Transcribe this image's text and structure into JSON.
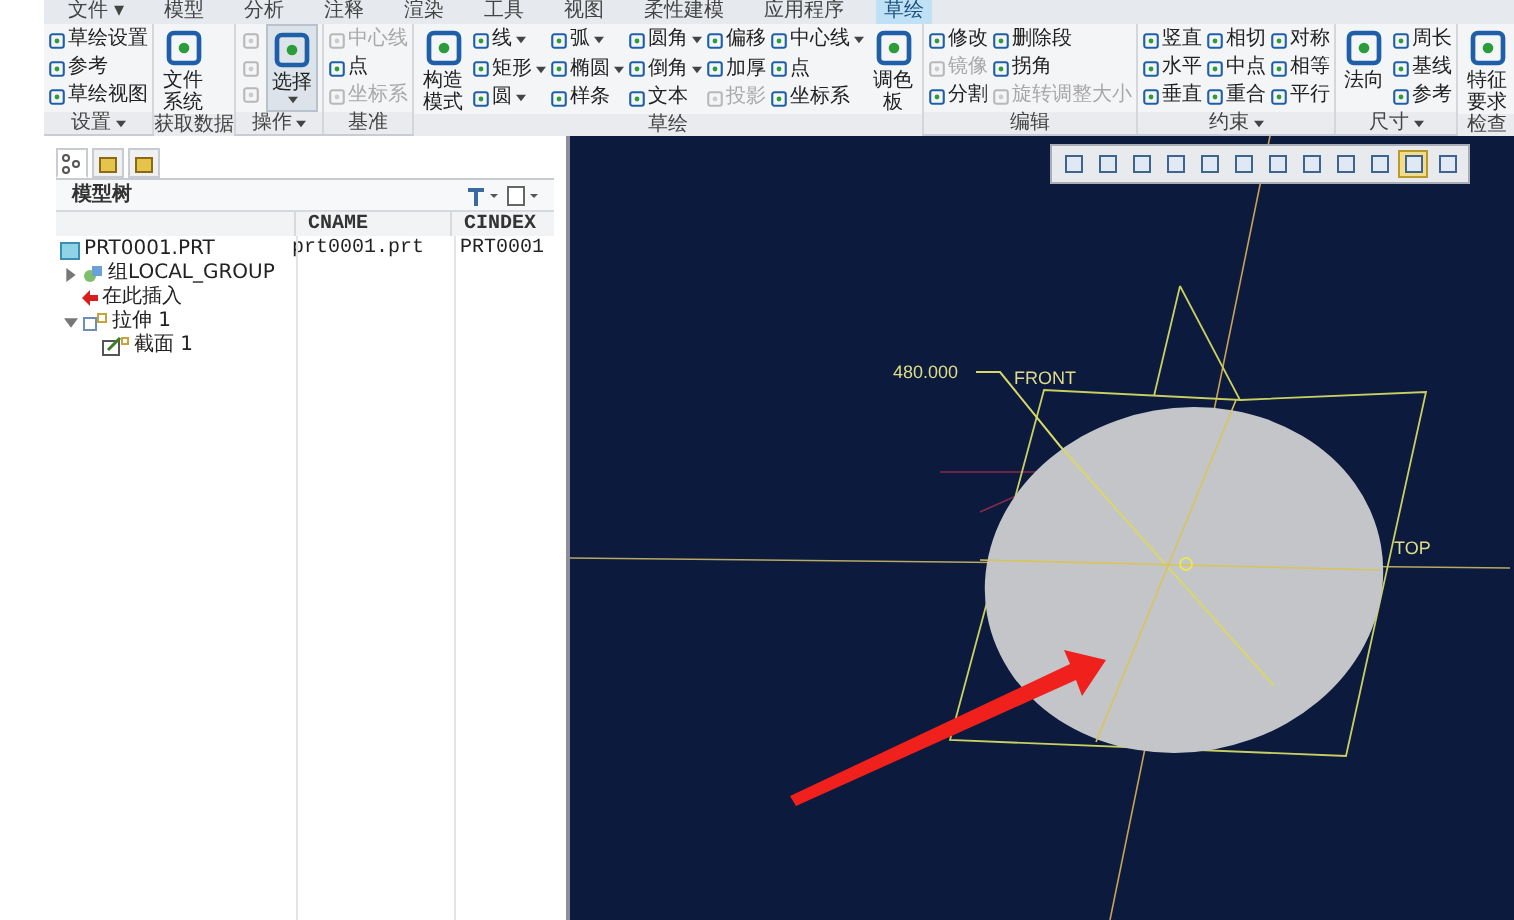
{
  "menu_tabs": [
    {
      "label": "文件 ▾",
      "selected": false
    },
    {
      "label": "模型",
      "selected": false
    },
    {
      "label": "分析",
      "selected": false
    },
    {
      "label": "注释",
      "selected": false
    },
    {
      "label": "渲染",
      "selected": false
    },
    {
      "label": "工具",
      "selected": false
    },
    {
      "label": "视图",
      "selected": false
    },
    {
      "label": "柔性建模",
      "selected": false
    },
    {
      "label": "应用程序",
      "selected": false
    },
    {
      "label": "草绘",
      "selected": true
    }
  ],
  "ribbon": [
    {
      "label": "设置",
      "menu": true,
      "columns": [
        {
          "kind": "stack",
          "items": [
            {
              "label": "草绘设置",
              "disabled": false,
              "menu": false
            },
            {
              "label": "参考",
              "disabled": false,
              "menu": false
            },
            {
              "label": "草绘视图",
              "disabled": false,
              "menu": false
            }
          ]
        }
      ]
    },
    {
      "label": "获取数据",
      "menu": false,
      "columns": [
        {
          "kind": "large",
          "label": "文件系统",
          "menu": false,
          "selected": false
        }
      ]
    },
    {
      "label": "操作",
      "menu": true,
      "columns": [
        {
          "kind": "icons",
          "items": [
            {
              "disabled": true
            },
            {
              "disabled": true
            },
            {
              "disabled": true
            }
          ]
        },
        {
          "kind": "large",
          "label": "选择",
          "menu": true,
          "selected": true
        }
      ]
    },
    {
      "label": "基准",
      "menu": false,
      "columns": [
        {
          "kind": "stack",
          "items": [
            {
              "label": "中心线",
              "disabled": true,
              "menu": false
            },
            {
              "label": "点",
              "disabled": false,
              "menu": false
            },
            {
              "label": "坐标系",
              "disabled": true,
              "menu": false
            }
          ]
        }
      ]
    },
    {
      "label": "草绘",
      "menu": false,
      "columns": [
        {
          "kind": "large",
          "label": "构造模式",
          "menu": false,
          "selected": false
        },
        {
          "kind": "stack",
          "items": [
            {
              "label": "线",
              "disabled": false,
              "menu": true
            },
            {
              "label": "矩形",
              "disabled": false,
              "menu": true
            },
            {
              "label": "圆",
              "disabled": false,
              "menu": true
            }
          ]
        },
        {
          "kind": "stack",
          "items": [
            {
              "label": "弧",
              "disabled": false,
              "menu": true
            },
            {
              "label": "椭圆",
              "disabled": false,
              "menu": true
            },
            {
              "label": "样条",
              "disabled": false,
              "menu": false
            }
          ]
        },
        {
          "kind": "stack",
          "items": [
            {
              "label": "圆角",
              "disabled": false,
              "menu": true
            },
            {
              "label": "倒角",
              "disabled": false,
              "menu": true
            },
            {
              "label": "文本",
              "disabled": false,
              "menu": false
            }
          ]
        },
        {
          "kind": "stack",
          "items": [
            {
              "label": "偏移",
              "disabled": false,
              "menu": false
            },
            {
              "label": "加厚",
              "disabled": false,
              "menu": false
            },
            {
              "label": "投影",
              "disabled": true,
              "menu": false
            }
          ]
        },
        {
          "kind": "stack",
          "items": [
            {
              "label": "中心线",
              "disabled": false,
              "menu": true
            },
            {
              "label": "点",
              "disabled": false,
              "menu": false
            },
            {
              "label": "坐标系",
              "disabled": false,
              "menu": false
            }
          ]
        },
        {
          "kind": "large",
          "label": "调色板",
          "menu": false,
          "selected": false
        }
      ]
    },
    {
      "label": "编辑",
      "menu": false,
      "columns": [
        {
          "kind": "stack",
          "items": [
            {
              "label": "修改",
              "disabled": false,
              "menu": false
            },
            {
              "label": "镜像",
              "disabled": true,
              "menu": false
            },
            {
              "label": "分割",
              "disabled": false,
              "menu": false
            }
          ]
        },
        {
          "kind": "stack",
          "items": [
            {
              "label": "删除段",
              "disabled": false,
              "menu": false
            },
            {
              "label": "拐角",
              "disabled": false,
              "menu": false
            },
            {
              "label": "旋转调整大小",
              "disabled": true,
              "menu": false
            }
          ]
        }
      ]
    },
    {
      "label": "约束",
      "menu": true,
      "columns": [
        {
          "kind": "stack",
          "items": [
            {
              "label": "竖直",
              "disabled": false,
              "menu": false
            },
            {
              "label": "水平",
              "disabled": false,
              "menu": false
            },
            {
              "label": "垂直",
              "disabled": false,
              "menu": false
            }
          ]
        },
        {
          "kind": "stack",
          "items": [
            {
              "label": "相切",
              "disabled": false,
              "menu": false
            },
            {
              "label": "中点",
              "disabled": false,
              "menu": false
            },
            {
              "label": "重合",
              "disabled": false,
              "menu": false
            }
          ]
        },
        {
          "kind": "stack",
          "items": [
            {
              "label": "对称",
              "disabled": false,
              "menu": false
            },
            {
              "label": "相等",
              "disabled": false,
              "menu": false
            },
            {
              "label": "平行",
              "disabled": false,
              "menu": false
            }
          ]
        }
      ]
    },
    {
      "label": "尺寸",
      "menu": true,
      "columns": [
        {
          "kind": "large",
          "label": "法向",
          "menu": false,
          "selected": false
        },
        {
          "kind": "stack",
          "items": [
            {
              "label": "周长",
              "disabled": false,
              "menu": false
            },
            {
              "label": "基线",
              "disabled": false,
              "menu": false
            },
            {
              "label": "参考",
              "disabled": false,
              "menu": false
            }
          ]
        }
      ]
    },
    {
      "label": "检查",
      "menu": false,
      "columns": [
        {
          "kind": "large",
          "label": "特征要求",
          "menu": false,
          "selected": false
        }
      ]
    }
  ],
  "panel_tabs": [
    {
      "selected": true
    },
    {
      "selected": false
    },
    {
      "selected": false
    }
  ],
  "model_tree": {
    "title": "模型树",
    "columns": [
      "CNAME",
      "CINDEX"
    ],
    "nodes": [
      {
        "kind": "part",
        "label": "PRT0001.PRT",
        "cname": "prt0001.prt",
        "cindex": "PRT0001",
        "children": [
          {
            "kind": "group",
            "label": "组LOCAL_GROUP",
            "expanded": false
          },
          {
            "kind": "insert",
            "label": "在此插入"
          },
          {
            "kind": "feature",
            "label": "拉伸 1",
            "expanded": true,
            "children": [
              {
                "kind": "section",
                "label": "截面 1"
              }
            ]
          }
        ]
      }
    ]
  },
  "view_toolbar": [
    {
      "selected": false
    },
    {
      "selected": false
    },
    {
      "selected": false
    },
    {
      "selected": false
    },
    {
      "selected": false
    },
    {
      "selected": false
    },
    {
      "selected": false
    },
    {
      "selected": false
    },
    {
      "selected": false
    },
    {
      "selected": false
    },
    {
      "selected": true
    },
    {
      "selected": false
    }
  ],
  "sketch": {
    "dimension": "480.000",
    "plane_labels": [
      "FRONT",
      "TOP"
    ]
  }
}
